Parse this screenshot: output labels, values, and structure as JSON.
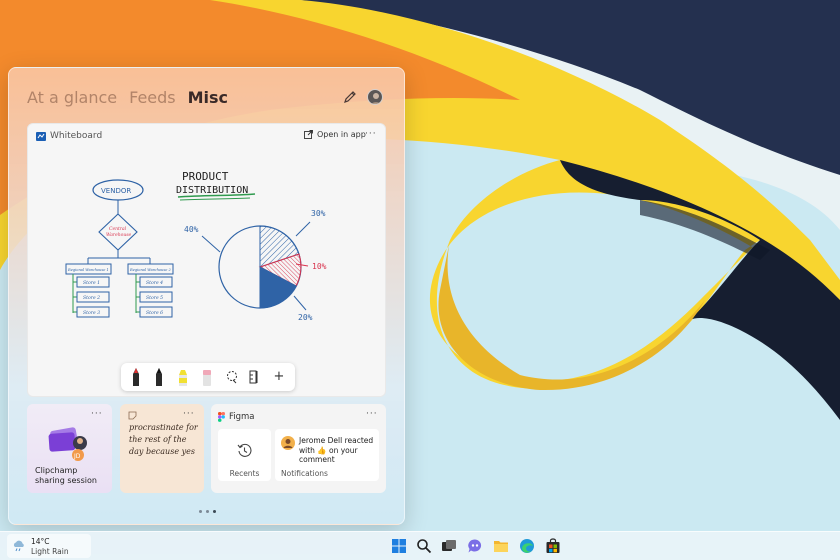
{
  "widgets": {
    "tabs": [
      {
        "label": "At a glance",
        "active": false
      },
      {
        "label": "Feeds",
        "active": false
      },
      {
        "label": "Misc",
        "active": true
      }
    ],
    "icons": {
      "edit": "pencil-icon",
      "profile": "avatar"
    }
  },
  "whiteboard": {
    "title": "Whiteboard",
    "open_label": "Open in app",
    "more": "···",
    "sketch": {
      "heading_line1": "PRODUCT",
      "heading_line2": "DISTRIBUTION",
      "vendor": "VENDOR",
      "central_line1": "Central",
      "central_line2": "Warehouse",
      "regional_left": "Regional Warehouse 1",
      "regional_right": "Regional Warehouse 2",
      "stores_left": [
        "Store 1",
        "Store 2",
        "Store 3"
      ],
      "stores_right": [
        "Store 4",
        "Store 5",
        "Store 6"
      ],
      "pie_labels": [
        "40%",
        "30%",
        "10%",
        "20%"
      ]
    },
    "toolbar": [
      "red-pen-icon",
      "black-pen-icon",
      "highlighter-icon",
      "eraser-icon",
      "lasso-icon",
      "ruler-icon",
      "add-icon"
    ],
    "toolbar_add": "+"
  },
  "clipchamp": {
    "label": "Clipchamp sharing session",
    "more": "···"
  },
  "sticky_note": {
    "text": "procrastinate for the rest of the day because yes",
    "more": "···"
  },
  "figma": {
    "title": "Figma",
    "more": "···",
    "recents_label": "Recents",
    "notification_text": "Jerome Dell reacted with 👍 on your comment",
    "notifications_label": "Notifications"
  },
  "taskbar": {
    "weather_temp": "14°C",
    "weather_desc": "Light Rain",
    "apps": [
      "windows-start-icon",
      "search-icon",
      "task-view-icon",
      "teams-chat-icon",
      "file-explorer-icon",
      "edge-browser-icon",
      "store-icon"
    ]
  },
  "colors": {
    "wall_orange": "#f58a2a",
    "wall_yellow": "#f7d631",
    "wall_navy": "#1f2d4c",
    "wall_sky": "#c9e9f2",
    "sketch_blue": "#2f63a6",
    "sketch_red": "#d8344e"
  }
}
